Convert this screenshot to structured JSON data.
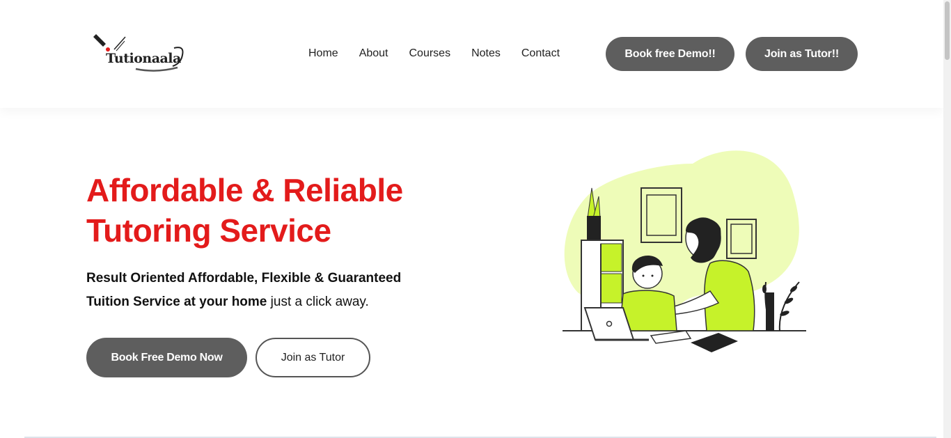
{
  "header": {
    "logo_text": "Tutionaala",
    "logo_icon": "pen-nib-icon",
    "nav": [
      "Home",
      "About",
      "Courses",
      "Notes",
      "Contact"
    ],
    "book_demo_label": "Book free Demo!!",
    "join_tutor_label": "Join as Tutor!!"
  },
  "hero": {
    "title_line1": "Affordable & Reliable",
    "title_line2": "Tutoring Service",
    "sub_bold_1": "Result Oriented Affordable, Flexible & Guaranteed",
    "sub_bold_2": "Tuition Service at your home",
    "sub_normal": " just a click away.",
    "primary_button": "Book Free Demo Now",
    "secondary_button": "Join as Tutor"
  },
  "colors": {
    "accent_red": "#e31b1b",
    "button_gray": "#5e5e5e",
    "illustration_green": "#c6f22a",
    "blob_green": "#eefcb8"
  }
}
